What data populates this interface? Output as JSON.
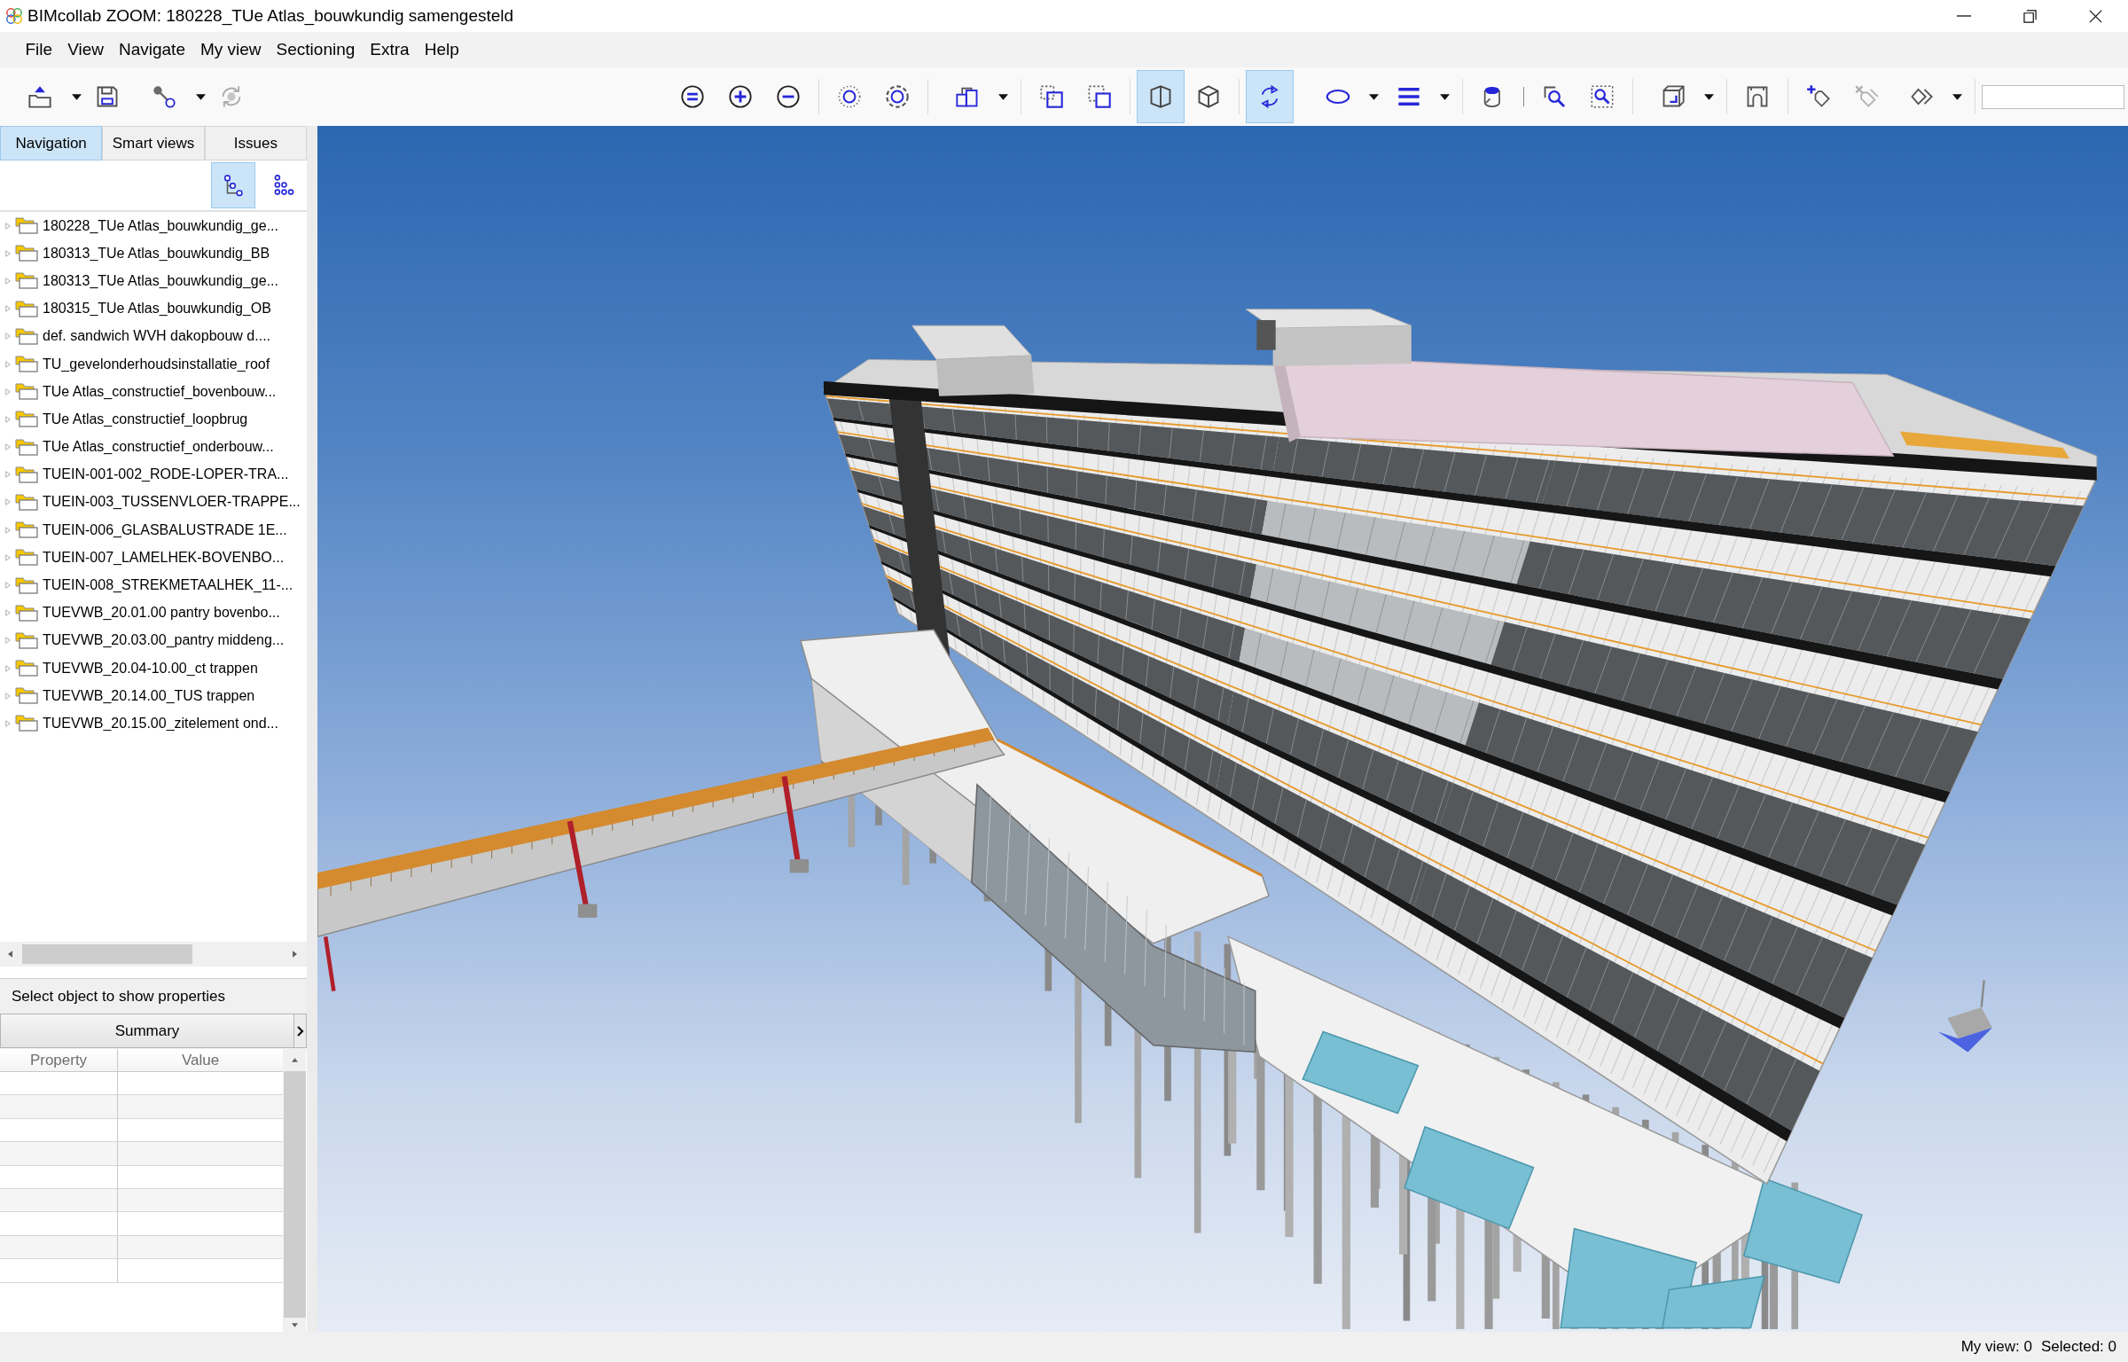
{
  "window": {
    "title": "BIMcollab ZOOM: 180228_TUe Atlas_bouwkundig samengesteld"
  },
  "menu": [
    "File",
    "View",
    "Navigate",
    "My view",
    "Sectioning",
    "Extra",
    "Help"
  ],
  "toolbar": {
    "left": [
      {
        "on": false,
        "disabled": false,
        "dropdown": true
      },
      {
        "on": false,
        "disabled": false,
        "dropdown": false
      },
      {
        "on": false,
        "disabled": false,
        "dropdown": true
      },
      {
        "on": false,
        "disabled": true,
        "dropdown": false
      }
    ],
    "right": [
      [
        {
          "on": false,
          "disabled": false,
          "dropdown": false
        },
        {
          "on": false,
          "disabled": false,
          "dropdown": false
        },
        {
          "on": false,
          "disabled": false,
          "dropdown": false
        }
      ],
      [
        {
          "on": false,
          "disabled": false,
          "dropdown": false
        },
        {
          "on": false,
          "disabled": false,
          "dropdown": false
        }
      ],
      [
        {
          "on": false,
          "disabled": false,
          "dropdown": true
        }
      ],
      [
        {
          "on": false,
          "disabled": false,
          "dropdown": false
        },
        {
          "on": false,
          "disabled": false,
          "dropdown": false
        }
      ],
      [
        {
          "on": true,
          "disabled": false,
          "dropdown": false
        },
        {
          "on": false,
          "disabled": false,
          "dropdown": false
        }
      ],
      [
        {
          "on": true,
          "disabled": false,
          "dropdown": false
        },
        {
          "on": false,
          "disabled": false,
          "dropdown": true
        },
        {
          "on": false,
          "disabled": false,
          "dropdown": true
        }
      ],
      [
        {
          "on": false,
          "disabled": false,
          "dropdown": false
        }
      ],
      [
        {
          "on": false,
          "disabled": false,
          "dropdown": false
        },
        {
          "on": false,
          "disabled": false,
          "dropdown": false
        }
      ],
      [
        {
          "on": false,
          "disabled": false,
          "dropdown": true
        }
      ],
      [
        {
          "on": false,
          "disabled": false,
          "dropdown": false
        }
      ],
      [
        {
          "on": false,
          "disabled": false,
          "dropdown": false
        },
        {
          "on": false,
          "disabled": true,
          "dropdown": false
        },
        {
          "on": false,
          "disabled": false,
          "dropdown": true
        }
      ]
    ]
  },
  "tabs": [
    {
      "label": "Navigation",
      "selected": true
    },
    {
      "label": "Smart views",
      "selected": false
    },
    {
      "label": "Issues",
      "selected": false
    }
  ],
  "tree": {
    "view_buttons": [
      {
        "selected": true
      },
      {
        "selected": false
      }
    ],
    "items": [
      {
        "label": "180228_TUe Atlas_bouwkundig_ge...",
        "expanded": false
      },
      {
        "label": "180313_TUe Atlas_bouwkundig_BB",
        "expanded": false
      },
      {
        "label": "180313_TUe Atlas_bouwkundig_ge...",
        "expanded": false
      },
      {
        "label": "180315_TUe Atlas_bouwkundig_OB",
        "expanded": false
      },
      {
        "label": "def. sandwich WVH dakopbouw d....",
        "expanded": false
      },
      {
        "label": "TU_gevelonderhoudsinstallatie_roof",
        "expanded": false
      },
      {
        "label": "TUe Atlas_constructief_bovenbouw...",
        "expanded": false
      },
      {
        "label": "TUe Atlas_constructief_loopbrug",
        "expanded": false
      },
      {
        "label": "TUe Atlas_constructief_onderbouw...",
        "expanded": false
      },
      {
        "label": "TUEIN-001-002_RODE-LOPER-TRA...",
        "expanded": false
      },
      {
        "label": "TUEIN-003_TUSSENVLOER-TRAPPE...",
        "expanded": false
      },
      {
        "label": "TUEIN-006_GLASBALUSTRADE 1E...",
        "expanded": false
      },
      {
        "label": "TUEIN-007_LAMELHEK-BOVENBO...",
        "expanded": false
      },
      {
        "label": "TUEIN-008_STREKMETAALHEK_11-...",
        "expanded": false
      },
      {
        "label": "TUEVWB_20.01.00 pantry bovenbo...",
        "expanded": false
      },
      {
        "label": "TUEVWB_20.03.00_pantry middeng...",
        "expanded": false
      },
      {
        "label": "TUEVWB_20.04-10.00_ct trappen",
        "expanded": false
      },
      {
        "label": "TUEVWB_20.14.00_TUS trappen",
        "expanded": false
      },
      {
        "label": "TUEVWB_20.15.00_zitelement ond...",
        "expanded": false
      }
    ]
  },
  "properties": {
    "hint": "Select object to show properties",
    "section": "Summary",
    "columns": [
      "Property",
      "Value"
    ]
  },
  "status_bar": [
    "My view: 0",
    "Selected: 0"
  ]
}
